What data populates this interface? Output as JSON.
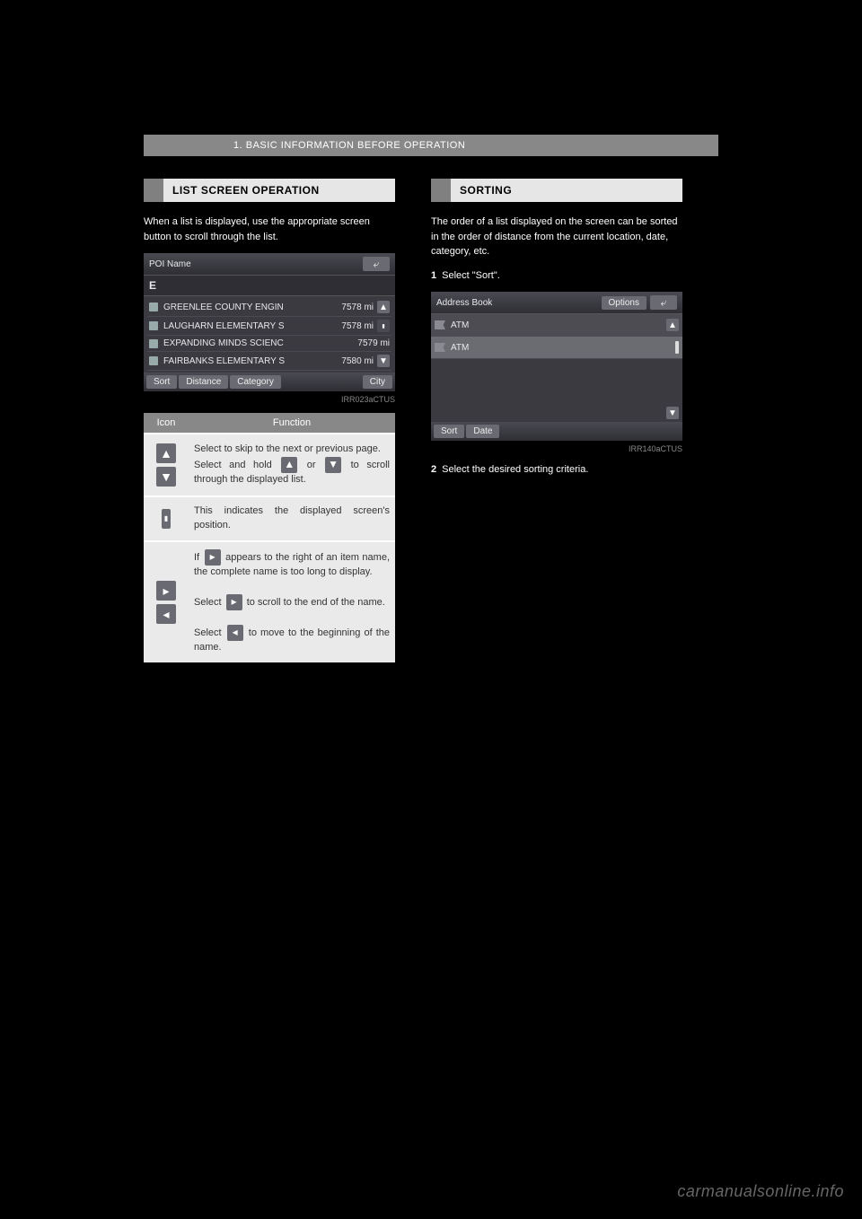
{
  "section_header": "1. BASIC INFORMATION BEFORE OPERATION",
  "left": {
    "subhead": "LIST SCREEN OPERATION",
    "intro": "When a list is displayed, use the appropriate screen button to scroll through the list.",
    "nav": {
      "title": "POI Name",
      "search_value": "E",
      "rows": [
        {
          "name": "GREENLEE COUNTY ENGIN",
          "dist": "7578 mi"
        },
        {
          "name": "LAUGHARN ELEMENTARY S",
          "dist": "7578 mi"
        },
        {
          "name": "EXPANDING MINDS SCIENC",
          "dist": "7579 mi"
        },
        {
          "name": "FAIRBANKS ELEMENTARY S",
          "dist": "7580 mi"
        }
      ],
      "bottom": {
        "sort": "Sort",
        "distance": "Distance",
        "category": "Category",
        "city": "City"
      },
      "caption": "IRR023aCTUS"
    },
    "table": {
      "head_icon": "Icon",
      "head_func": "Function",
      "row1a": "Select to skip to the next or previous page.",
      "row1b_pre": "Select and hold ",
      "row1b_mid": " or ",
      "row1b_post": " to scroll through the displayed list.",
      "row2": "This indicates the displayed screen's position.",
      "row3_1_pre": "If ",
      "row3_1_post": " appears to the right of an item name, the complete name is too long to display.",
      "row3_2_pre": "Select ",
      "row3_2_post": " to scroll to the end of the name.",
      "row3_3_pre": "Select ",
      "row3_3_post": " to move to the beginning of the name."
    }
  },
  "right": {
    "subhead": "SORTING",
    "intro": "The order of a list displayed on the screen can be sorted in the order of distance from the current location, date, category, etc.",
    "step1": "Select \"Sort\".",
    "nav": {
      "title": "Address Book",
      "options": "Options",
      "rows": [
        {
          "name": "ATM"
        },
        {
          "name": "ATM"
        }
      ],
      "bottom": {
        "sort": "Sort",
        "date": "Date"
      },
      "caption": "IRR140aCTUS"
    },
    "step2": "Select the desired sorting criteria."
  },
  "watermark": "carmanualsonline.info"
}
